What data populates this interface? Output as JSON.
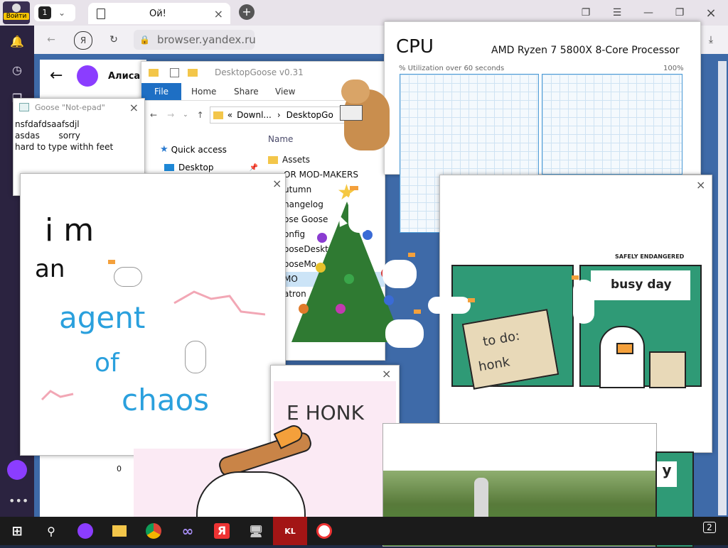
{
  "browser": {
    "login_label": "Войти",
    "tab_count": "1",
    "tab_title": "Ой!",
    "url": "browser.yandex.ru",
    "alice_label": "Алиса"
  },
  "explorer": {
    "title": "DesktopGoose v0.31",
    "ribbon_tabs": [
      "File",
      "Home",
      "Share",
      "View"
    ],
    "path": [
      "Downl...",
      "DesktopGo"
    ],
    "path_prefix": "«",
    "column_name": "Name",
    "quick_access": "Quick access",
    "desktop": "Desktop",
    "items": [
      "Assets",
      "OR MOD-MAKERS",
      "utumn",
      "hangelog",
      "ose Goose",
      "onfig",
      "ooseDeskt",
      "ooseMo",
      "MO",
      "atron"
    ]
  },
  "notepad": {
    "title": "Goose \"Not-epad\"",
    "lines": [
      "nsfdafdsaafsdjl",
      "asdas       sorry",
      "hard to type withh feet"
    ]
  },
  "task_manager": {
    "heading": "CPU",
    "processor": "AMD Ryzen 7 5800X 8-Core Processor",
    "utilization_label": "% Utilization over 60 seconds",
    "max_label": "100%"
  },
  "drawing": {
    "line1": "i m",
    "line2": "an",
    "line3": "agent",
    "line4": "of",
    "line5": "chaos"
  },
  "comic": {
    "brand": "SAFELY ENDANGERED",
    "panel1_text": [
      "to do:",
      "honk"
    ],
    "panel2_text": "busy day"
  },
  "honk_meme": {
    "text": "E HONK"
  },
  "misc": {
    "left_cell_value": "0",
    "bottom_letter": "y"
  },
  "taskbar": {
    "notification_count": "2",
    "ya_label": "Я",
    "kl_label": "KL"
  },
  "colors": {
    "explorer_blue": "#1e6fc4",
    "comic_green": "#2f9a76",
    "drawing_blue": "#2aa0dd",
    "drawing_pink": "#f2a7b5",
    "taskbar": "#1b1b1b"
  }
}
